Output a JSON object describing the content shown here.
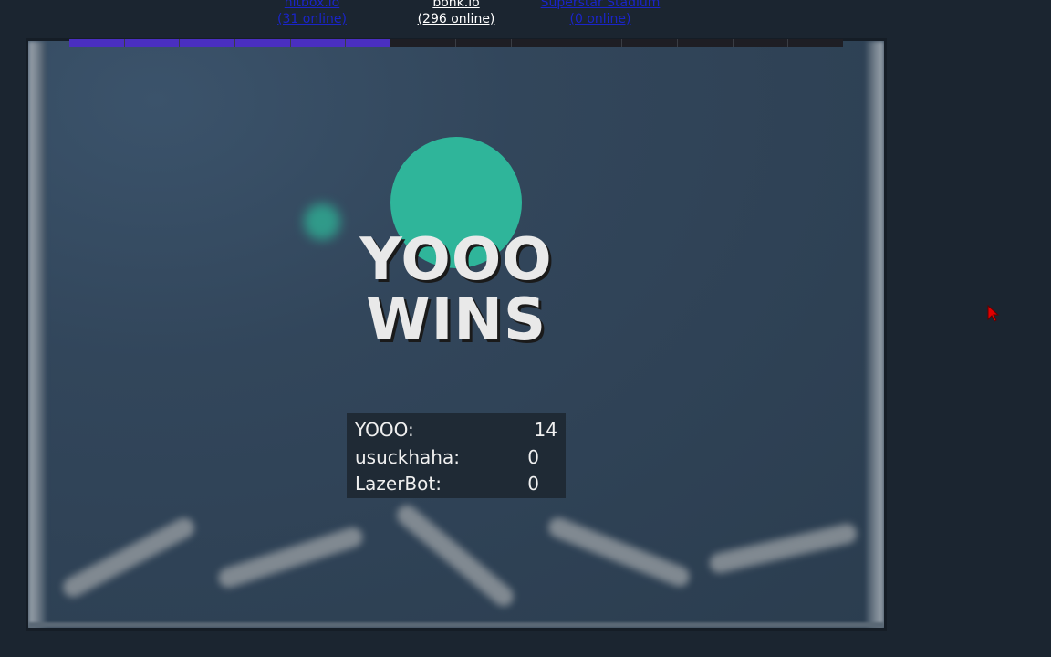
{
  "top_links": [
    {
      "name": "hitbox.io",
      "online": "(31 online)",
      "active": false
    },
    {
      "name": "bonk.io",
      "online": "(296 online)",
      "active": true
    },
    {
      "name": "Superstar Stadium",
      "online": "(0 online)",
      "active": false
    }
  ],
  "round_progress": 0.415,
  "winner": {
    "line1": "YOOO",
    "line2": "WINS",
    "ball_color": "#2fb59a"
  },
  "scoreboard": [
    {
      "player": "YOOO:",
      "score": "14"
    },
    {
      "player": "usuckhaha:",
      "score": "0"
    },
    {
      "player": "LazerBot:",
      "score": "0"
    }
  ],
  "colors": {
    "background": "#1b2530",
    "progress_fill": "#4a2fc0",
    "link_dim": "#1a25c8",
    "link_active": "#ffffff"
  }
}
